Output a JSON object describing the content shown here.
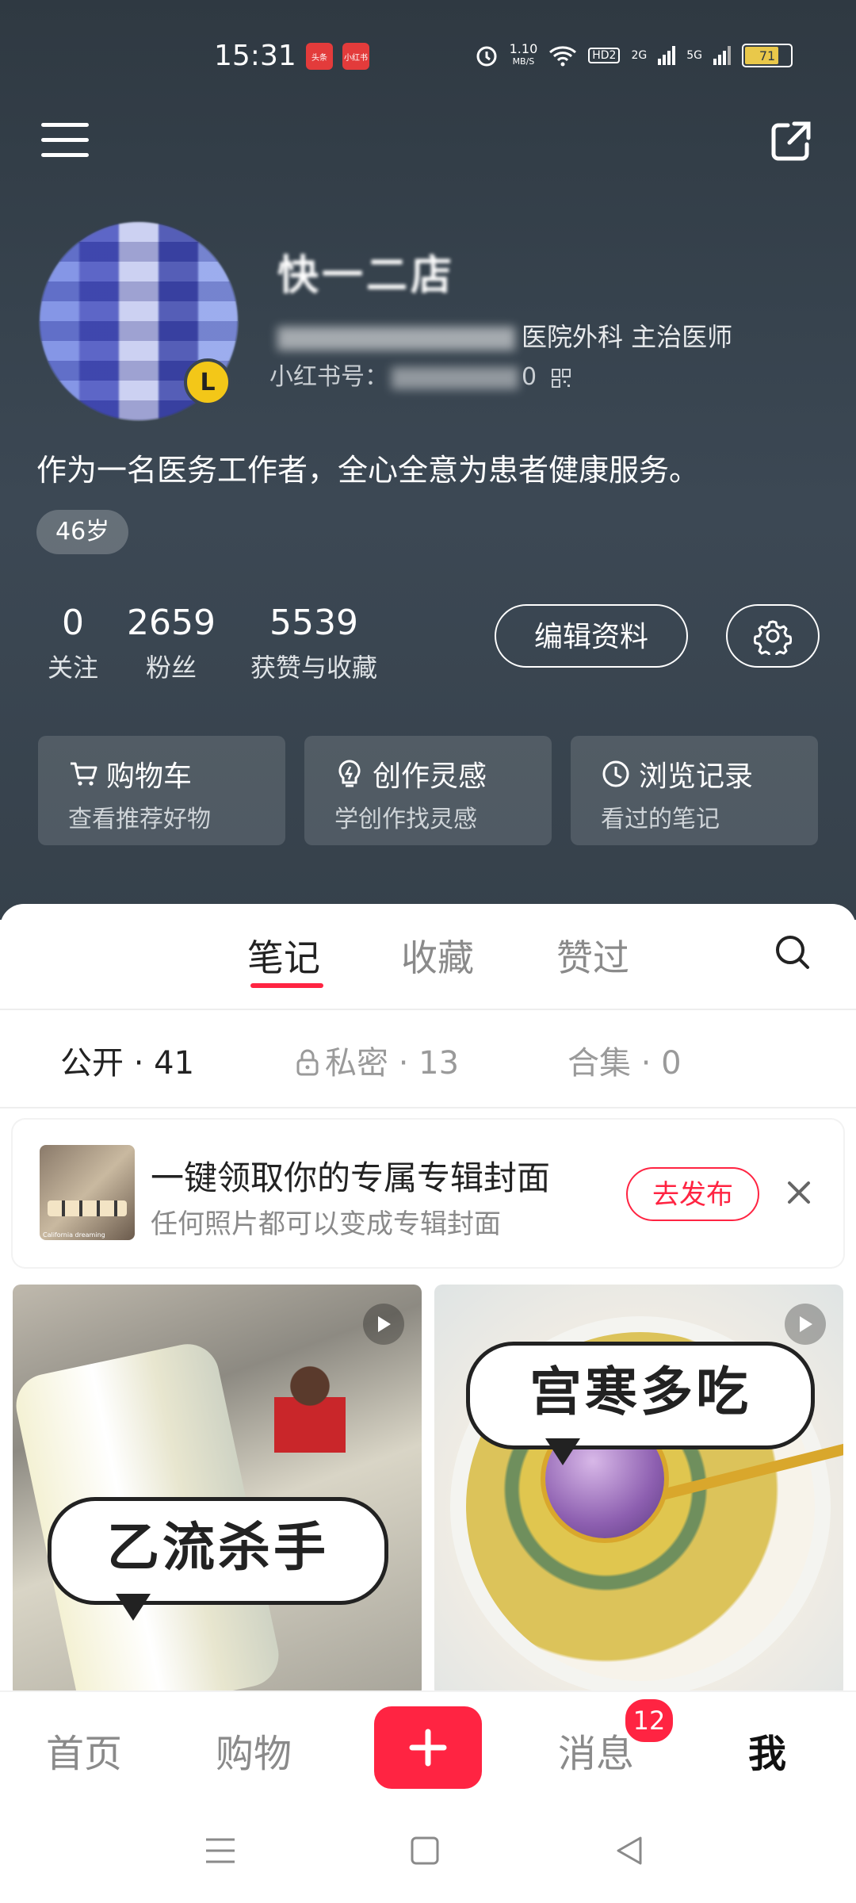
{
  "status_bar": {
    "time": "15:31",
    "app_badges": [
      "头条",
      "小红书"
    ],
    "net_speed_value": "1.10",
    "net_speed_unit": "MB/S",
    "hd_label": "HD2",
    "signal_1": "2G",
    "signal_2": "5G",
    "battery": "71"
  },
  "profile": {
    "username": "快一二店",
    "title": "医院外科 主治医师",
    "id_label": "小红书号：",
    "id_tail": "0",
    "bio": "作为一名医务工作者，全心全意为患者健康服务。",
    "age_tag": "46岁",
    "level_badge": "L"
  },
  "stats": [
    {
      "value": "0",
      "label": "关注"
    },
    {
      "value": "2659",
      "label": "粉丝"
    },
    {
      "value": "5539",
      "label": "获赞与收藏"
    }
  ],
  "buttons": {
    "edit_profile": "编辑资料"
  },
  "quick_cards": [
    {
      "title": "购物车",
      "subtitle": "查看推荐好物",
      "icon": "cart-icon"
    },
    {
      "title": "创作灵感",
      "subtitle": "学创作找灵感",
      "icon": "bulb-icon"
    },
    {
      "title": "浏览记录",
      "subtitle": "看过的笔记",
      "icon": "clock-icon"
    }
  ],
  "tabs": [
    {
      "label": "笔记",
      "active": true
    },
    {
      "label": "收藏",
      "active": false
    },
    {
      "label": "赞过",
      "active": false
    }
  ],
  "subtabs": [
    {
      "label": "公开 · 41"
    },
    {
      "label": "私密 · 13"
    },
    {
      "label": "合集 · 0"
    }
  ],
  "promo": {
    "title": "一键领取你的专属专辑封面",
    "subtitle": "任何照片都可以变成专辑封面",
    "button": "去发布",
    "thumb_caption": "California dreaming"
  },
  "notes": [
    {
      "caption": "乙流杀手"
    },
    {
      "caption": "宫寒多吃"
    }
  ],
  "bottom_nav": {
    "home": "首页",
    "shop": "购物",
    "messages": "消息",
    "messages_badge": "12",
    "me": "我"
  },
  "colors": {
    "accent": "#ff2442",
    "header_bg": "#36414b"
  }
}
